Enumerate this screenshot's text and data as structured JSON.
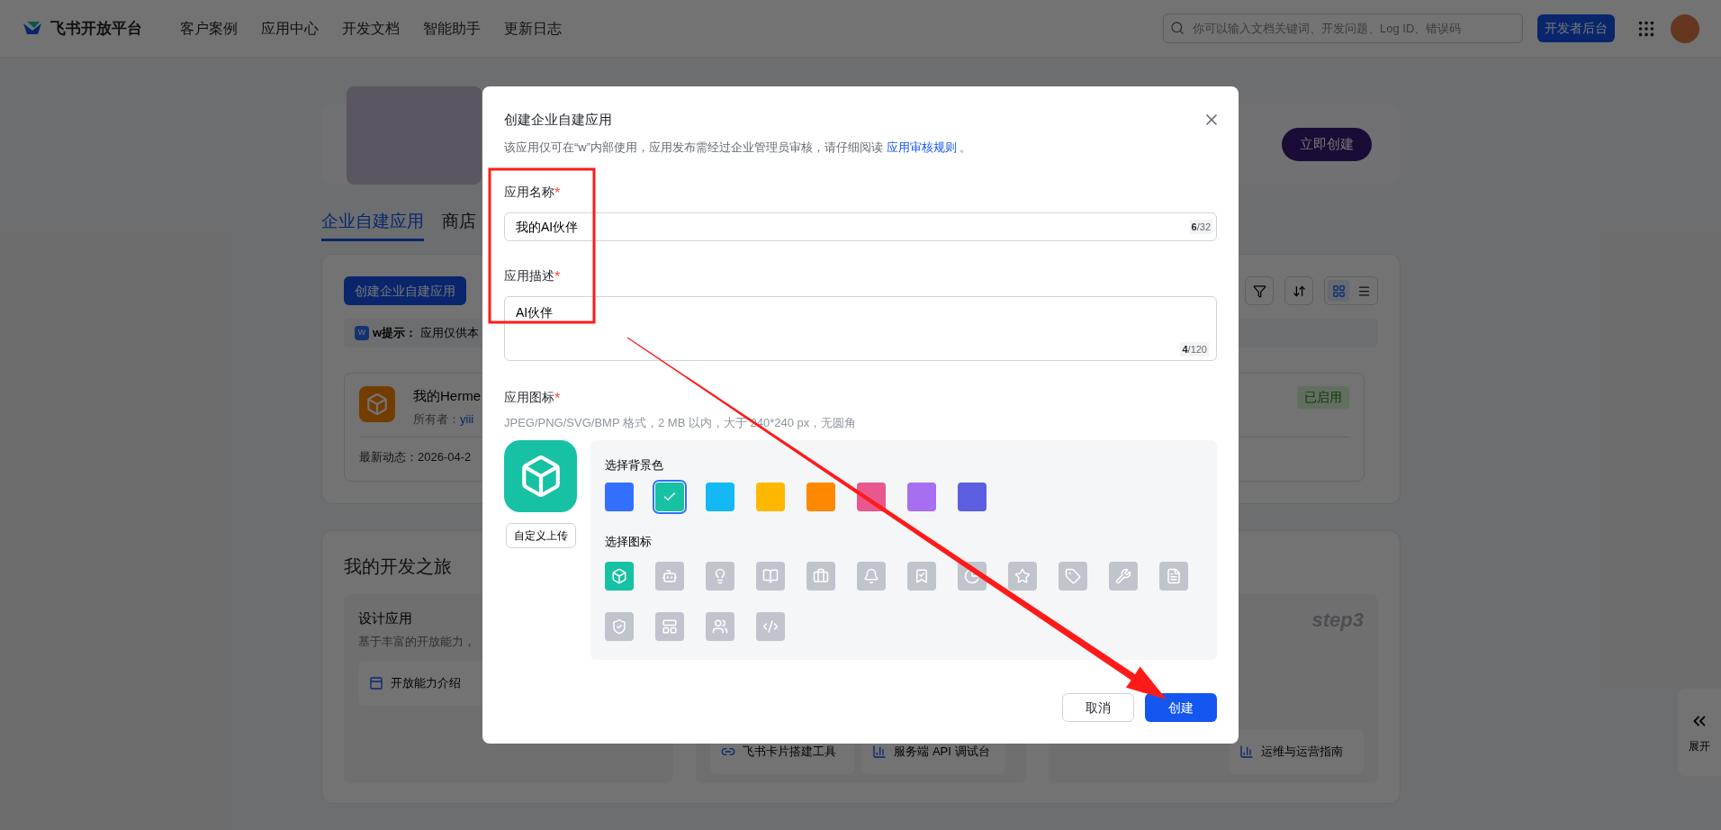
{
  "header": {
    "logo": "飞书开放平台",
    "nav": [
      "客户案例",
      "应用中心",
      "开发文档",
      "智能助手",
      "更新日志"
    ],
    "search": {
      "placeholder": "你可以输入文档关键词、开发问题、Log ID、错误码"
    },
    "console_button": "开发者后台"
  },
  "banner": {
    "button": "立即创建"
  },
  "tabs": [
    {
      "label": "企业自建应用",
      "selected": true
    },
    {
      "label": "商店",
      "selected": false
    }
  ],
  "apps_panel": {
    "create_button": "创建企业自建应用",
    "tip": {
      "badge": "W",
      "label": "w提示：",
      "text": "应用仅供本"
    },
    "view_modes": [
      {
        "kind": "grid",
        "selected": true
      },
      {
        "kind": "list",
        "selected": false
      }
    ],
    "app": {
      "name": "我的Herme",
      "owner_label": "所有者：",
      "owner": "yiii",
      "activity": "最新动态：2026-04-2",
      "status": "已启用"
    }
  },
  "journey": {
    "title": "我的开发之旅",
    "steps": [
      {
        "title": "设计应用",
        "description": "基于丰富的开放能力，",
        "links": [
          "开放能力介绍"
        ]
      },
      {
        "links": [
          "飞书卡片搭建工具",
          "服务端 API 调试台"
        ]
      },
      {
        "step_label": "step3",
        "links": [
          "运维与运营指南"
        ]
      }
    ]
  },
  "side_tab": {
    "label": "展开"
  },
  "dialog": {
    "title": "创建企业自建应用",
    "notice": {
      "text": "该应用仅可在“w”内部使用，应用发布需经过企业管理员审核，请仔细阅读",
      "link": "应用审核规则",
      "tail": "。"
    },
    "fields": [
      {
        "kind": "input",
        "label": "应用名称",
        "required_mark": "*",
        "value": "我的AI伙伴",
        "count": "6",
        "limit": "/32"
      },
      {
        "kind": "textarea",
        "label": "应用描述",
        "required_mark": "*",
        "value": "AI伙伴",
        "count": "4",
        "limit": "/120"
      }
    ],
    "icon_section": {
      "label": "应用图标",
      "required_mark": "*",
      "hint": "JPEG/PNG/SVG/BMP 格式，2 MB 以内，大于 240*240 px，无圆角",
      "upload_button": "自定义上传",
      "color_title": "选择背景色",
      "colors": [
        {
          "color": "#3370ff",
          "selected": false
        },
        {
          "color": "#16c2a3",
          "selected": true
        },
        {
          "color": "#14b8f5",
          "selected": false
        },
        {
          "color": "#ffb800",
          "selected": false
        },
        {
          "color": "#ff8800",
          "selected": false
        },
        {
          "color": "#e9578f",
          "selected": false
        },
        {
          "color": "#a66ef0",
          "selected": false
        },
        {
          "color": "#5b5fe0",
          "selected": false
        }
      ],
      "icon_title": "选择图标",
      "icons": [
        {
          "kind": "cube",
          "selected": true
        },
        {
          "kind": "robot",
          "selected": false
        },
        {
          "kind": "bulb",
          "selected": false
        },
        {
          "kind": "book",
          "selected": false
        },
        {
          "kind": "briefcase",
          "selected": false
        },
        {
          "kind": "bell",
          "selected": false
        },
        {
          "kind": "bookmark",
          "selected": false
        },
        {
          "kind": "pie",
          "selected": false
        },
        {
          "kind": "star",
          "selected": false
        },
        {
          "kind": "tag",
          "selected": false
        },
        {
          "kind": "wrench",
          "selected": false
        },
        {
          "kind": "document",
          "selected": false
        },
        {
          "kind": "shield",
          "selected": false
        },
        {
          "kind": "layout",
          "selected": false
        },
        {
          "kind": "people",
          "selected": false
        },
        {
          "kind": "code",
          "selected": false
        }
      ]
    },
    "buttons": [
      {
        "kind": "secondary",
        "label": "取消"
      },
      {
        "kind": "primary",
        "label": "创建"
      }
    ]
  }
}
